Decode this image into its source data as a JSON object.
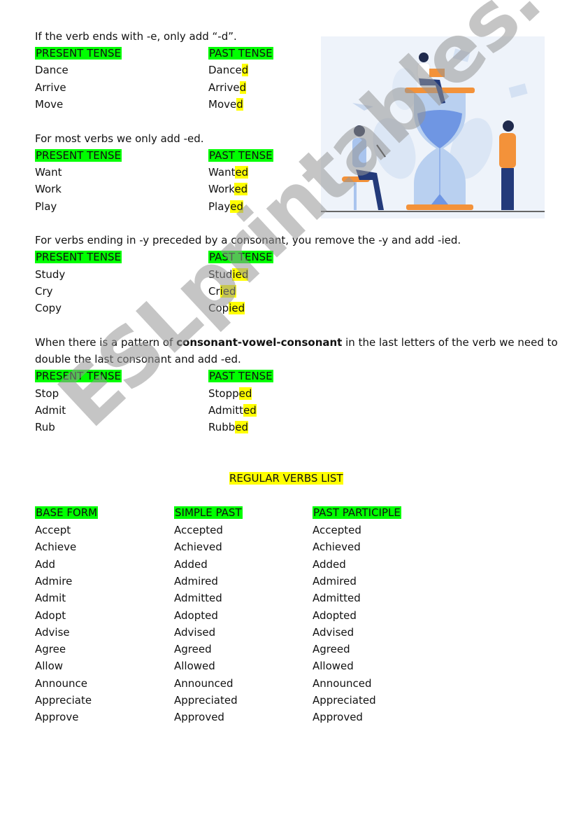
{
  "sections": [
    {
      "rule": "If the verb ends with -e, only add “-d”.",
      "headers": [
        "PRESENT TENSE",
        "PAST TENSE"
      ],
      "rows": [
        {
          "present": "Dance",
          "past_stem": "Dance",
          "past_suffix": "d"
        },
        {
          "present": "Arrive",
          "past_stem": "Arrive",
          "past_suffix": "d"
        },
        {
          "present": "Move",
          "past_stem": "Move",
          "past_suffix": "d"
        }
      ]
    },
    {
      "rule": "For most verbs we only add -ed.",
      "headers": [
        "PRESENT TENSE",
        "PAST TENSE"
      ],
      "rows": [
        {
          "present": "Want",
          "past_stem": "Want",
          "past_suffix": "ed"
        },
        {
          "present": "Work",
          "past_stem": "Work",
          "past_suffix": "ed"
        },
        {
          "present": "Play",
          "past_stem": "Play",
          "past_suffix": "ed"
        }
      ]
    },
    {
      "rule": "For verbs ending in -y preceded by a consonant, you remove the -y and add -ied.",
      "headers": [
        "PRESENT TENSE",
        "PAST TENSE"
      ],
      "rows": [
        {
          "present": "Study",
          "past_stem": "Stud",
          "past_suffix": "ied"
        },
        {
          "present": "Cry",
          "past_stem": "Cr",
          "past_suffix": "ied"
        },
        {
          "present": "Copy",
          "past_stem": "Cop",
          "past_suffix": "ied"
        }
      ]
    },
    {
      "rule_prefix": "When there is a pattern of ",
      "rule_bold": "consonant-vowel-consonant",
      "rule_suffix": " in the last letters of the verb we need to",
      "rule_line2": "double the last consonant and add -ed.",
      "headers": [
        "PRESENT TENSE",
        "PAST TENSE"
      ],
      "rows": [
        {
          "present": "Stop",
          "past_stem": "Stopp",
          "past_suffix": "ed"
        },
        {
          "present": "Admit",
          "past_stem": "Admitt",
          "past_suffix": "ed"
        },
        {
          "present": "Rub",
          "past_stem": "Rubb",
          "past_suffix": "ed"
        }
      ]
    }
  ],
  "list": {
    "title": "REGULAR VERBS LIST",
    "headers": [
      "BASE FORM",
      "SIMPLE PAST",
      "PAST PARTICIPLE"
    ],
    "rows": [
      [
        "Accept",
        "Accepted",
        "Accepted"
      ],
      [
        "Achieve",
        "Achieved",
        "Achieved"
      ],
      [
        "Add",
        "Added",
        "Added"
      ],
      [
        "Admire",
        "Admired",
        "Admired"
      ],
      [
        "Admit",
        "Admitted",
        "Admitted"
      ],
      [
        "Adopt",
        "Adopted",
        "Adopted"
      ],
      [
        "Advise",
        "Advised",
        "Advised"
      ],
      [
        "Agree",
        "Agreed",
        "Agreed"
      ],
      [
        "Allow",
        "Allowed",
        "Allowed"
      ],
      [
        "Announce",
        "Announced",
        "Announced"
      ],
      [
        "Appreciate",
        "Appreciated",
        "Appreciated"
      ],
      [
        "Approve",
        "Approved",
        "Approved"
      ]
    ]
  },
  "illustration": {
    "icon": "hourglass-people-illustration"
  },
  "watermark": "ESLprintables.com",
  "colors": {
    "header_highlight": "#00ff00",
    "suffix_highlight": "#ffff00"
  }
}
